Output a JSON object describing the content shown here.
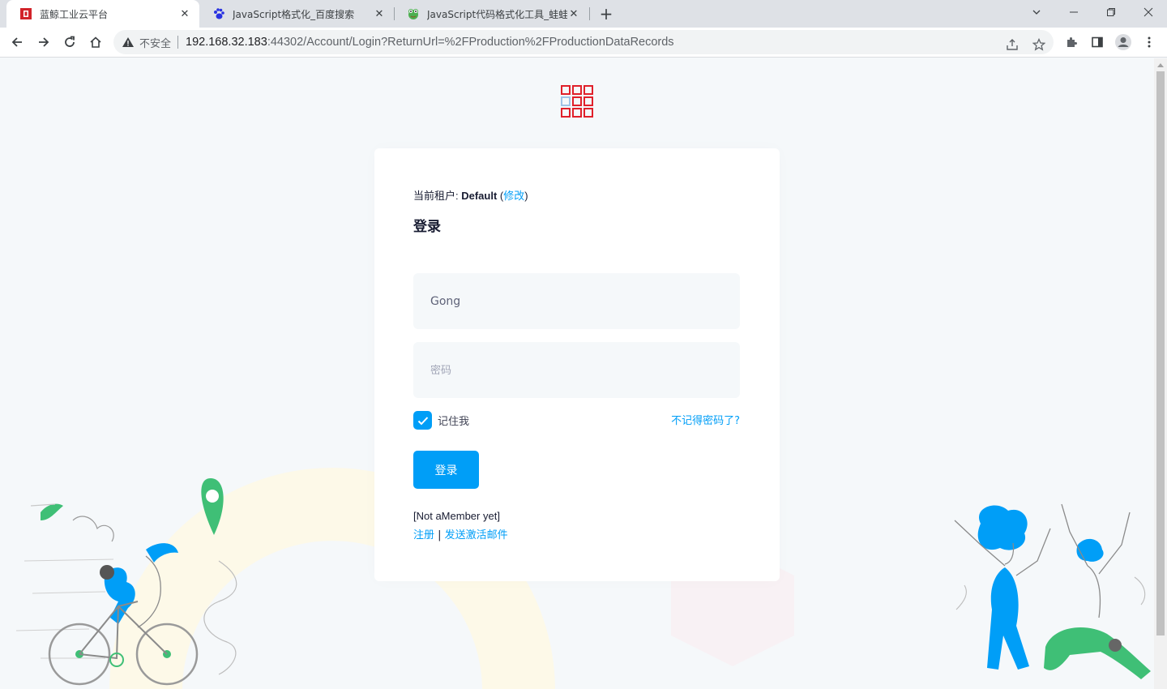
{
  "browser": {
    "tabs": [
      {
        "title": "蓝鲸工业云平台",
        "active": true
      },
      {
        "title": "JavaScript格式化_百度搜索",
        "active": false
      },
      {
        "title": "JavaScript代码格式化工具_蛙蛙",
        "active": false
      }
    ],
    "new_tab_glyph": "+",
    "close_glyph": "✕",
    "insecure_label": "不安全",
    "url_host": "192.168.32.183",
    "url_rest": ":44302/Account/Login?ReturnUrl=%2FProduction%2FProductionDataRecords"
  },
  "login": {
    "tenant_prefix": "当前租户: ",
    "tenant_name": "Default",
    "tenant_change_open": " (",
    "tenant_change": "修改",
    "tenant_change_close": ")",
    "title": "登录",
    "username_value": "Gong",
    "password_placeholder": "密码",
    "remember_label": "记住我",
    "remember_checked": true,
    "forgot_label": "不记得密码了?",
    "submit_label": "登录",
    "not_member": "[Not aMember yet]",
    "register_label": "注册",
    "links_separator": " | ",
    "activate_label": "发送激活邮件"
  },
  "colors": {
    "primary": "#009ef7",
    "logo_red": "#e0202a",
    "page_bg": "#f5f8fa"
  },
  "icons": [
    "back-arrow-icon",
    "forward-arrow-icon",
    "reload-icon",
    "home-icon",
    "warning-icon",
    "share-icon",
    "star-icon",
    "extensions-icon",
    "side-panel-icon",
    "profile-icon",
    "menu-icon"
  ]
}
